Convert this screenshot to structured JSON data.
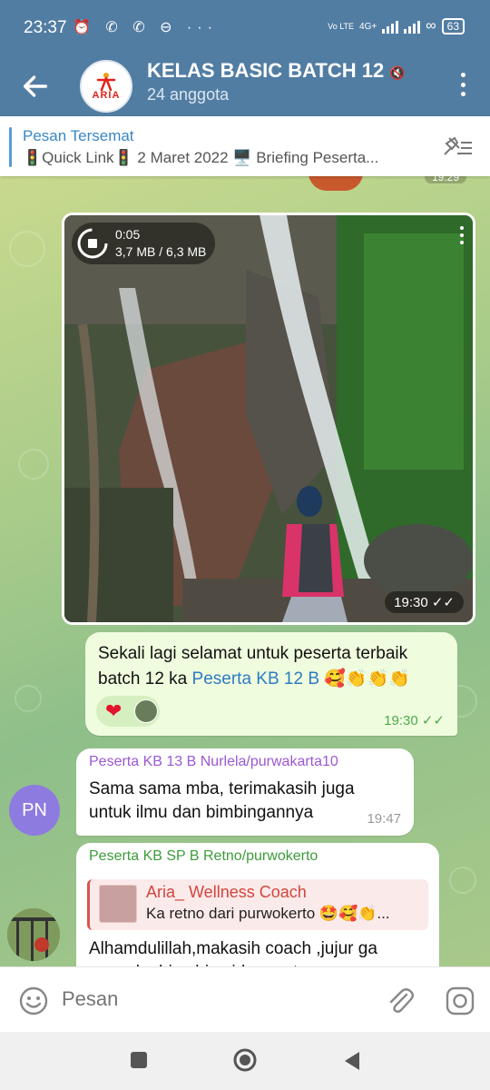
{
  "status_bar": {
    "time": "23:37",
    "icons": "⏰ ✆ ✆ ⊖ ···",
    "network": "4G+",
    "volte": "Vo LTE",
    "battery": "63"
  },
  "header": {
    "title": "KELAS BASIC BATCH 12",
    "subtitle": "24 anggota",
    "avatar_text": "ARIA"
  },
  "pinned": {
    "label": "Pesan Tersemat",
    "text": "🚦Quick Link🚦 2 Maret 2022 🖥️ Briefing Peserta..."
  },
  "chat": {
    "top_stub_time": "19:29",
    "media": {
      "duration": "0:05",
      "size": "3,7 MB / 6,3 MB",
      "time": "19:30"
    },
    "outgoing": {
      "text_before": "Sekali lagi selamat untuk peserta terbaik batch 12 ka ",
      "mention": "Peserta KB 12 B",
      "text_after": " 🥰👏👏👏",
      "reaction": "❤",
      "time": "19:30"
    },
    "incoming1": {
      "avatar": "PN",
      "sender": "Peserta KB 13 B Nurlela/purwakarta10",
      "text": "Sama sama mba, terimakasih juga untuk ilmu dan bimbingannya",
      "time": "19:47"
    },
    "incoming2": {
      "sender": "Peserta KB SP B Retno/purwokerto",
      "reply_name": "Aria_ Wellness Coach",
      "reply_text": "Ka retno dari purwokerto 🤩🥰👏...",
      "text": "Alhamdulillah,makasih coach ,jujur ga nyangka bisa bisa jd peserta"
    }
  },
  "input": {
    "placeholder": "Pesan"
  },
  "colors": {
    "header": "#527da3",
    "outgoing_bubble": "#effdde",
    "mention": "#2d7bc2"
  }
}
